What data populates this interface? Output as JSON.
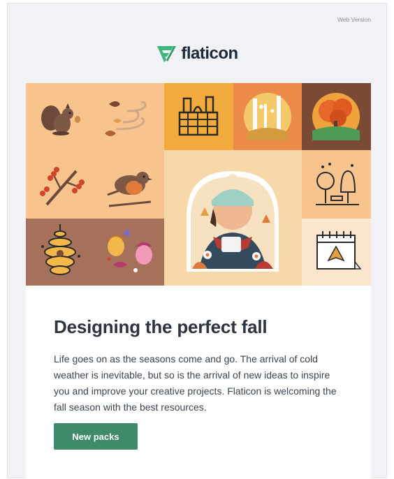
{
  "header": {
    "web_version_label": "Web Version"
  },
  "logo": {
    "text": "flaticon",
    "icon": "flaticon-logo-icon",
    "brand_color": "#3fb57f"
  },
  "hero": {
    "tiles": [
      {
        "icon": "squirrel-icon"
      },
      {
        "icon": "autumn-wind-leaves-icon"
      },
      {
        "icon": "picnic-basket-icon"
      },
      {
        "icon": "birch-forest-icon"
      },
      {
        "icon": "autumn-tree-icon"
      },
      {
        "icon": "rowan-berries-branch-icon"
      },
      {
        "icon": "robin-bird-icon"
      },
      {
        "icon": "person-with-warm-drink-illustration"
      },
      {
        "icon": "park-trees-bench-icon"
      },
      {
        "icon": "beehive-icon"
      },
      {
        "icon": "acorns-icon"
      },
      {
        "icon": "autumn-calendar-icon"
      }
    ]
  },
  "content": {
    "title": "Designing the perfect fall",
    "body": "Life goes on as the seasons come and go. The arrival of cold weather is inevitable, but so is the arrival of new ideas to inspire you and improve your creative projects. Flaticon is welcoming the fall season with the best resources.",
    "cta_label": "New packs",
    "cta_color": "#3f8a68"
  }
}
